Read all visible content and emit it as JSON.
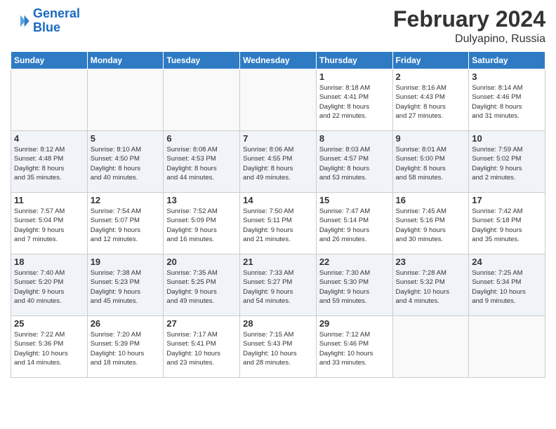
{
  "header": {
    "logo_line1": "General",
    "logo_line2": "Blue",
    "month_title": "February 2024",
    "location": "Dulyapino, Russia"
  },
  "weekdays": [
    "Sunday",
    "Monday",
    "Tuesday",
    "Wednesday",
    "Thursday",
    "Friday",
    "Saturday"
  ],
  "weeks": [
    [
      {
        "day": "",
        "info": ""
      },
      {
        "day": "",
        "info": ""
      },
      {
        "day": "",
        "info": ""
      },
      {
        "day": "",
        "info": ""
      },
      {
        "day": "1",
        "info": "Sunrise: 8:18 AM\nSunset: 4:41 PM\nDaylight: 8 hours\nand 22 minutes."
      },
      {
        "day": "2",
        "info": "Sunrise: 8:16 AM\nSunset: 4:43 PM\nDaylight: 8 hours\nand 27 minutes."
      },
      {
        "day": "3",
        "info": "Sunrise: 8:14 AM\nSunset: 4:46 PM\nDaylight: 8 hours\nand 31 minutes."
      }
    ],
    [
      {
        "day": "4",
        "info": "Sunrise: 8:12 AM\nSunset: 4:48 PM\nDaylight: 8 hours\nand 35 minutes."
      },
      {
        "day": "5",
        "info": "Sunrise: 8:10 AM\nSunset: 4:50 PM\nDaylight: 8 hours\nand 40 minutes."
      },
      {
        "day": "6",
        "info": "Sunrise: 8:08 AM\nSunset: 4:53 PM\nDaylight: 8 hours\nand 44 minutes."
      },
      {
        "day": "7",
        "info": "Sunrise: 8:06 AM\nSunset: 4:55 PM\nDaylight: 8 hours\nand 49 minutes."
      },
      {
        "day": "8",
        "info": "Sunrise: 8:03 AM\nSunset: 4:57 PM\nDaylight: 8 hours\nand 53 minutes."
      },
      {
        "day": "9",
        "info": "Sunrise: 8:01 AM\nSunset: 5:00 PM\nDaylight: 8 hours\nand 58 minutes."
      },
      {
        "day": "10",
        "info": "Sunrise: 7:59 AM\nSunset: 5:02 PM\nDaylight: 9 hours\nand 2 minutes."
      }
    ],
    [
      {
        "day": "11",
        "info": "Sunrise: 7:57 AM\nSunset: 5:04 PM\nDaylight: 9 hours\nand 7 minutes."
      },
      {
        "day": "12",
        "info": "Sunrise: 7:54 AM\nSunset: 5:07 PM\nDaylight: 9 hours\nand 12 minutes."
      },
      {
        "day": "13",
        "info": "Sunrise: 7:52 AM\nSunset: 5:09 PM\nDaylight: 9 hours\nand 16 minutes."
      },
      {
        "day": "14",
        "info": "Sunrise: 7:50 AM\nSunset: 5:11 PM\nDaylight: 9 hours\nand 21 minutes."
      },
      {
        "day": "15",
        "info": "Sunrise: 7:47 AM\nSunset: 5:14 PM\nDaylight: 9 hours\nand 26 minutes."
      },
      {
        "day": "16",
        "info": "Sunrise: 7:45 AM\nSunset: 5:16 PM\nDaylight: 9 hours\nand 30 minutes."
      },
      {
        "day": "17",
        "info": "Sunrise: 7:42 AM\nSunset: 5:18 PM\nDaylight: 9 hours\nand 35 minutes."
      }
    ],
    [
      {
        "day": "18",
        "info": "Sunrise: 7:40 AM\nSunset: 5:20 PM\nDaylight: 9 hours\nand 40 minutes."
      },
      {
        "day": "19",
        "info": "Sunrise: 7:38 AM\nSunset: 5:23 PM\nDaylight: 9 hours\nand 45 minutes."
      },
      {
        "day": "20",
        "info": "Sunrise: 7:35 AM\nSunset: 5:25 PM\nDaylight: 9 hours\nand 49 minutes."
      },
      {
        "day": "21",
        "info": "Sunrise: 7:33 AM\nSunset: 5:27 PM\nDaylight: 9 hours\nand 54 minutes."
      },
      {
        "day": "22",
        "info": "Sunrise: 7:30 AM\nSunset: 5:30 PM\nDaylight: 9 hours\nand 59 minutes."
      },
      {
        "day": "23",
        "info": "Sunrise: 7:28 AM\nSunset: 5:32 PM\nDaylight: 10 hours\nand 4 minutes."
      },
      {
        "day": "24",
        "info": "Sunrise: 7:25 AM\nSunset: 5:34 PM\nDaylight: 10 hours\nand 9 minutes."
      }
    ],
    [
      {
        "day": "25",
        "info": "Sunrise: 7:22 AM\nSunset: 5:36 PM\nDaylight: 10 hours\nand 14 minutes."
      },
      {
        "day": "26",
        "info": "Sunrise: 7:20 AM\nSunset: 5:39 PM\nDaylight: 10 hours\nand 18 minutes."
      },
      {
        "day": "27",
        "info": "Sunrise: 7:17 AM\nSunset: 5:41 PM\nDaylight: 10 hours\nand 23 minutes."
      },
      {
        "day": "28",
        "info": "Sunrise: 7:15 AM\nSunset: 5:43 PM\nDaylight: 10 hours\nand 28 minutes."
      },
      {
        "day": "29",
        "info": "Sunrise: 7:12 AM\nSunset: 5:46 PM\nDaylight: 10 hours\nand 33 minutes."
      },
      {
        "day": "",
        "info": ""
      },
      {
        "day": "",
        "info": ""
      }
    ]
  ]
}
